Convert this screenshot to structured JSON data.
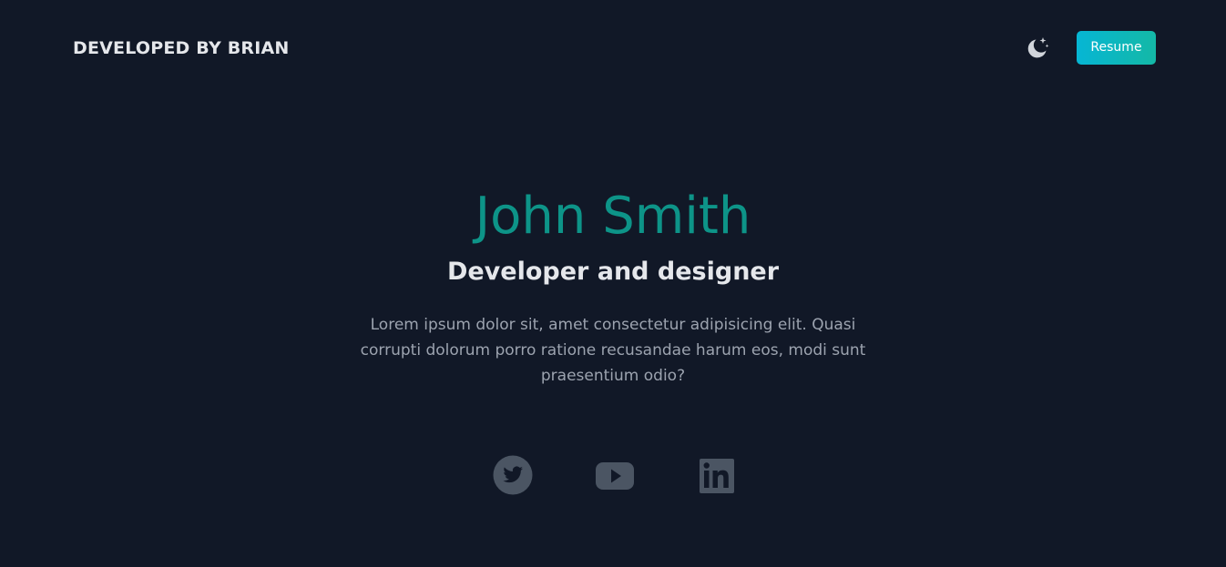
{
  "nav": {
    "brand": "DEVELOPED BY BRIAN",
    "theme_toggle_icon": "moon-stars-icon",
    "resume_label": "Resume"
  },
  "hero": {
    "name": "John Smith",
    "role": "Developer and designer",
    "description": "Lorem ipsum dolor sit, amet consectetur adipisicing elit. Quasi corrupti dolorum porro ratione recusandae harum eos, modi sunt praesentium odio?"
  },
  "social": [
    {
      "icon": "twitter-icon"
    },
    {
      "icon": "youtube-icon"
    },
    {
      "icon": "linkedin-icon"
    }
  ],
  "colors": {
    "background": "#111827",
    "accent": "#0d9488",
    "button_gradient_start": "#06b6d4",
    "button_gradient_end": "#14b8a6",
    "icon_muted": "#4b5563"
  }
}
